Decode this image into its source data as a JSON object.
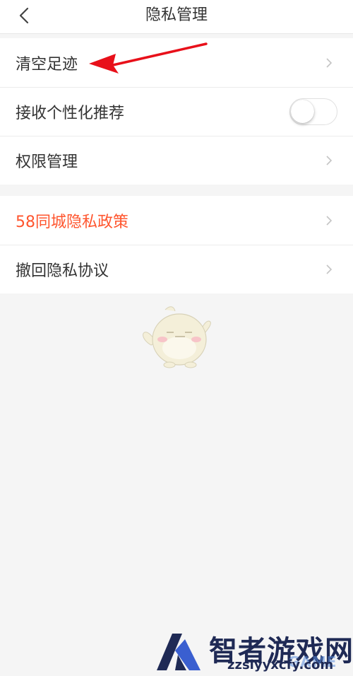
{
  "header": {
    "title": "隐私管理",
    "back_icon": "chevron-left-icon"
  },
  "settings": {
    "group1": [
      {
        "label": "清空足迹",
        "control": "chevron"
      },
      {
        "label": "接收个性化推荐",
        "control": "toggle",
        "toggle_on": false
      },
      {
        "label": "权限管理",
        "control": "chevron"
      }
    ],
    "group2": [
      {
        "label": "58同城隐私政策",
        "control": "chevron",
        "color": "#ff552e"
      },
      {
        "label": "撤回隐私协议",
        "control": "chevron"
      }
    ]
  },
  "colors": {
    "accent": "#ff552e",
    "annotation_arrow": "#e8101a",
    "page_bg": "#f5f5f5"
  },
  "watermark": {
    "title": "智者游戏网",
    "domain": "zzslyyxcfy.com",
    "overlay": "GAME"
  }
}
